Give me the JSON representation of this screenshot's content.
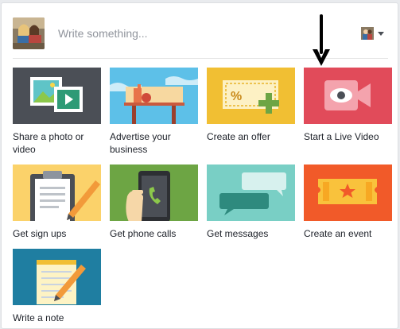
{
  "composer": {
    "placeholder": "Write something..."
  },
  "tiles": [
    {
      "label": "Share a photo or video",
      "icon": "photo-video-icon",
      "bg": "#4b4f56"
    },
    {
      "label": "Advertise your business",
      "icon": "storefront-icon",
      "bg": "#5dc0e8"
    },
    {
      "label": "Create an offer",
      "icon": "offer-ticket-icon",
      "bg": "#f1bf33"
    },
    {
      "label": "Start a Live Video",
      "icon": "live-video-camera-icon",
      "bg": "#e14b5a"
    },
    {
      "label": "Get sign ups",
      "icon": "clipboard-icon",
      "bg": "#fbd26a"
    },
    {
      "label": "Get phone calls",
      "icon": "phone-call-icon",
      "bg": "#6da544"
    },
    {
      "label": "Get messages",
      "icon": "chat-bubbles-icon",
      "bg": "#79cfc5"
    },
    {
      "label": "Create an event",
      "icon": "event-ticket-icon",
      "bg": "#f15a29"
    },
    {
      "label": "Write a note",
      "icon": "note-pencil-icon",
      "bg": "#1f7ea1"
    }
  ]
}
